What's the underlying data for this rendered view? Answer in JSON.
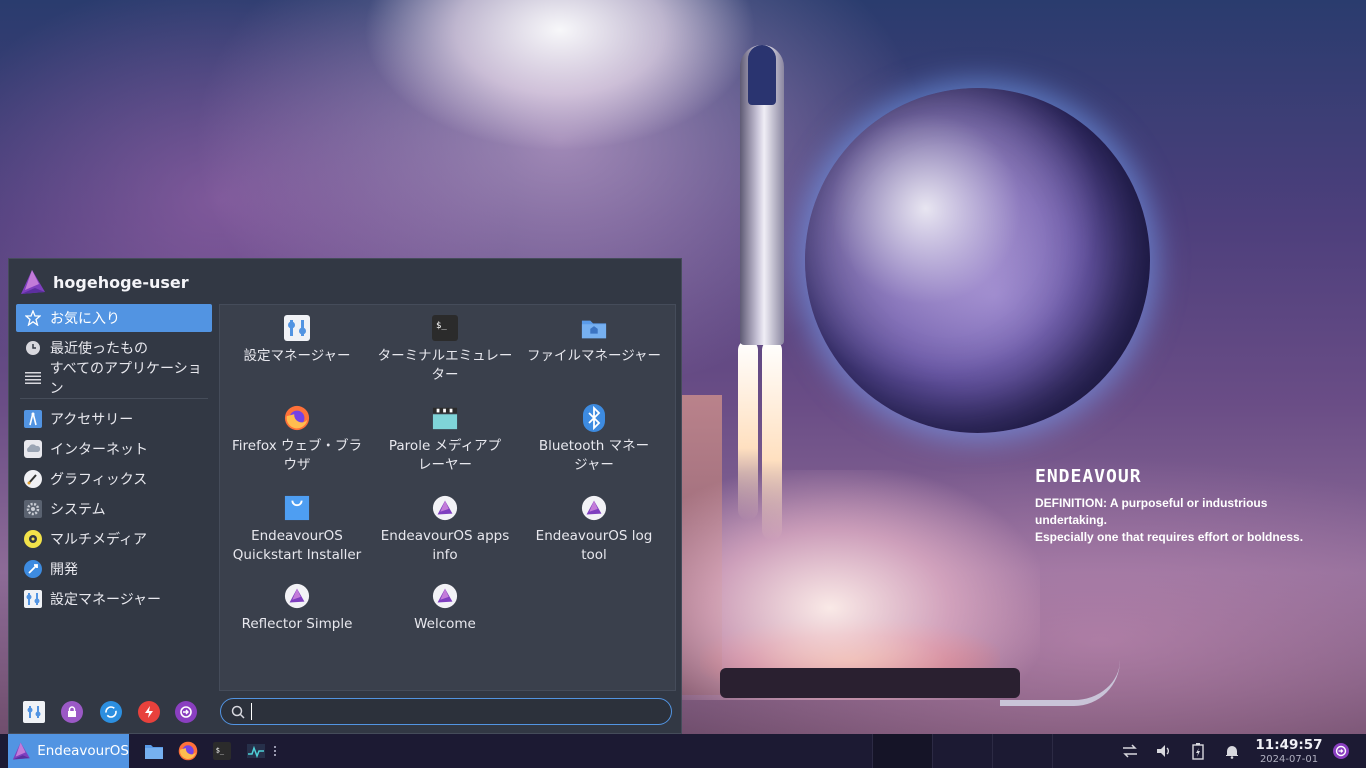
{
  "wallpaper": {
    "title": "ENDEAVOUR",
    "definition_line1": "DEFINITION: A purposeful or industrious undertaking.",
    "definition_line2": "Especially one that requires effort or boldness."
  },
  "menu": {
    "user_name": "hogehoge-user",
    "categories": [
      {
        "label": "お気に入り",
        "icon": "star-icon",
        "active": true
      },
      {
        "label": "最近使ったもの",
        "icon": "clock-icon"
      },
      {
        "label": "すべてのアプリケーション",
        "icon": "list-icon"
      }
    ],
    "groups": [
      {
        "label": "アクセサリー",
        "icon": "accessories-icon"
      },
      {
        "label": "インターネット",
        "icon": "cloud-icon"
      },
      {
        "label": "グラフィックス",
        "icon": "graphics-icon"
      },
      {
        "label": "システム",
        "icon": "gear-icon"
      },
      {
        "label": "マルチメディア",
        "icon": "multimedia-icon"
      },
      {
        "label": "開発",
        "icon": "development-icon"
      },
      {
        "label": "設定マネージャー",
        "icon": "settings-manager-icon"
      }
    ],
    "apps": [
      {
        "line1": "設定マネージャー",
        "line2": "",
        "icon": "settings-manager-icon"
      },
      {
        "line1": "ターミナルエミュレー",
        "line2": "ター",
        "icon": "terminal-icon"
      },
      {
        "line1": "ファイルマネージャー",
        "line2": "",
        "icon": "folder-icon"
      },
      {
        "line1": "Firefox ウェブ・ブラ",
        "line2": "ウザ",
        "icon": "firefox-icon"
      },
      {
        "line1": "Parole メディアプ",
        "line2": "レーヤー",
        "icon": "clapperboard-icon"
      },
      {
        "line1": "Bluetooth マネー",
        "line2": "ジャー",
        "icon": "bluetooth-icon"
      },
      {
        "line1": "EndeavourOS",
        "line2": "Quickstart Installer",
        "icon": "shopping-bag-icon"
      },
      {
        "line1": "EndeavourOS apps",
        "line2": "info",
        "icon": "endeavouros-icon"
      },
      {
        "line1": "EndeavourOS log",
        "line2": "tool",
        "icon": "endeavouros-icon"
      },
      {
        "line1": "Reflector Simple",
        "line2": "",
        "icon": "endeavouros-icon"
      },
      {
        "line1": "Welcome",
        "line2": "",
        "icon": "endeavouros-icon"
      }
    ],
    "actions": [
      "settings-icon",
      "lock-icon",
      "switch-user-icon",
      "power-icon",
      "logout-icon"
    ],
    "search": {
      "value": "",
      "placeholder": ""
    }
  },
  "taskbar": {
    "start_label": "EndeavourOS",
    "launchers": [
      "file-manager-icon",
      "firefox-icon",
      "terminal-icon",
      "system-monitor-icon"
    ],
    "clock_time": "11:49:57",
    "clock_date": "2024-07-01"
  },
  "colors": {
    "accent": "#5294e2",
    "menu_bg": "#323844",
    "apps_bg": "#3a404c",
    "taskbar_bg": "#1c1a33",
    "eos_purple": "#7f3fbf"
  }
}
